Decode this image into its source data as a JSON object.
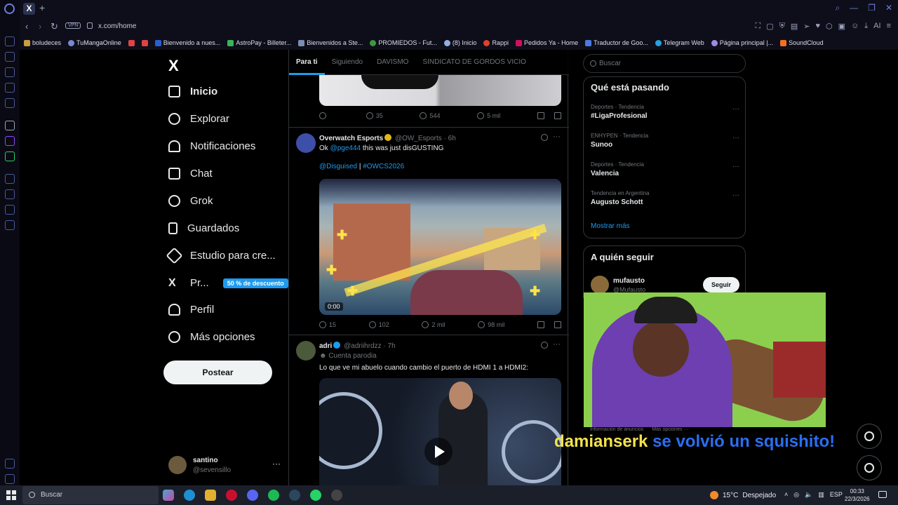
{
  "browser": {
    "url": "x.com/home",
    "vpn_label": "VPN",
    "tab_title": "X",
    "ai_label": "AI",
    "bookmarks": [
      "boludeces",
      "TuMangaOnline",
      "",
      "",
      "Bienvenido a nues...",
      "AstroPay - Billeter...",
      "Bienvenidos a Ste...",
      "PROMIEDOS - Fut...",
      "(8) Inicio",
      "Rappi",
      "Pedidos Ya - Home",
      "Traductor de Goo...",
      "Telegram Web",
      "Página principal |...",
      "SoundCloud"
    ]
  },
  "nav": {
    "logo": "X",
    "items": [
      {
        "label": "Inicio",
        "icon": "home-icon"
      },
      {
        "label": "Explorar",
        "icon": "search-icon"
      },
      {
        "label": "Notificaciones",
        "icon": "bell-icon"
      },
      {
        "label": "Chat",
        "icon": "mail-icon"
      },
      {
        "label": "Grok",
        "icon": "grok-icon"
      },
      {
        "label": "Guardados",
        "icon": "bookmark-icon"
      },
      {
        "label": "Estudio para cre...",
        "icon": "rocket-icon"
      },
      {
        "label": "Pr...",
        "icon": "x-premium-icon"
      },
      {
        "label": "Perfil",
        "icon": "user-icon"
      },
      {
        "label": "Más opciones",
        "icon": "more-circle-icon"
      }
    ],
    "promo_badge": "50 % de descuento",
    "post_button": "Postear",
    "account": {
      "name": "santino",
      "handle": "@sevensillo",
      "dots": "···"
    }
  },
  "timeline": {
    "tabs": [
      "Para ti",
      "Siguiendo",
      "DAVISMO",
      "SINDICATO DE GORDOS VICIO"
    ],
    "top_actions": {
      "replies": "",
      "reposts": "35",
      "likes": "544",
      "views": "5 mil"
    },
    "tweets": [
      {
        "name": "Overwatch Esports",
        "handle": "@OW_Esports",
        "time": "· 6h",
        "text_prefix": "Ok ",
        "mention": "@pge444",
        "text_suffix": " this was just disGUSTING",
        "link1": "@Disguised",
        "sep": " | ",
        "link2": "#OWCS2026",
        "media_time": "0:00",
        "actions": {
          "replies": "15",
          "reposts": "102",
          "likes": "2 mil",
          "views": "98 mil"
        }
      },
      {
        "name": "adri",
        "handle": "@adriihrdzz",
        "time": "· 7h",
        "parody": "Cuenta parodia",
        "text": "Lo que ve mi abuelo cuando cambio el puerto de HDMI 1 a HDMI2:"
      }
    ]
  },
  "right": {
    "search_placeholder": "Buscar",
    "trending_title": "Qué está pasando",
    "trends": [
      {
        "context": "Deportes · Tendencia",
        "title": "#LigaProfesional"
      },
      {
        "context": "ENHYPEN · Tendencia",
        "title": "Sunoo"
      },
      {
        "context": "Deportes · Tendencia",
        "title": "Valencia"
      },
      {
        "context": "Tendencia en Argentina",
        "title": "Augusto Schott"
      }
    ],
    "show_more": "Mostrar más",
    "who_to_follow_title": "A quién seguir",
    "suggested": {
      "name": "mufausto",
      "handle": "@Mufausto_",
      "button": "Seguir"
    },
    "ad_info": "Información de anuncios",
    "more_options": "Más opciones ···"
  },
  "overlay": {
    "user": "damianserk",
    "message": " se volvió un squishito!"
  },
  "taskbar": {
    "search": "Buscar",
    "whatsapp_badge": "28",
    "temperature": "15°C",
    "weather": "Despejado",
    "lang": "ESP",
    "time": "00:33",
    "date": "22/3/2026"
  },
  "colors": {
    "accent": "#1d9bf0",
    "background": "#000000",
    "overlay_user": "#f4e24a",
    "overlay_msg": "#2a6ef0"
  }
}
